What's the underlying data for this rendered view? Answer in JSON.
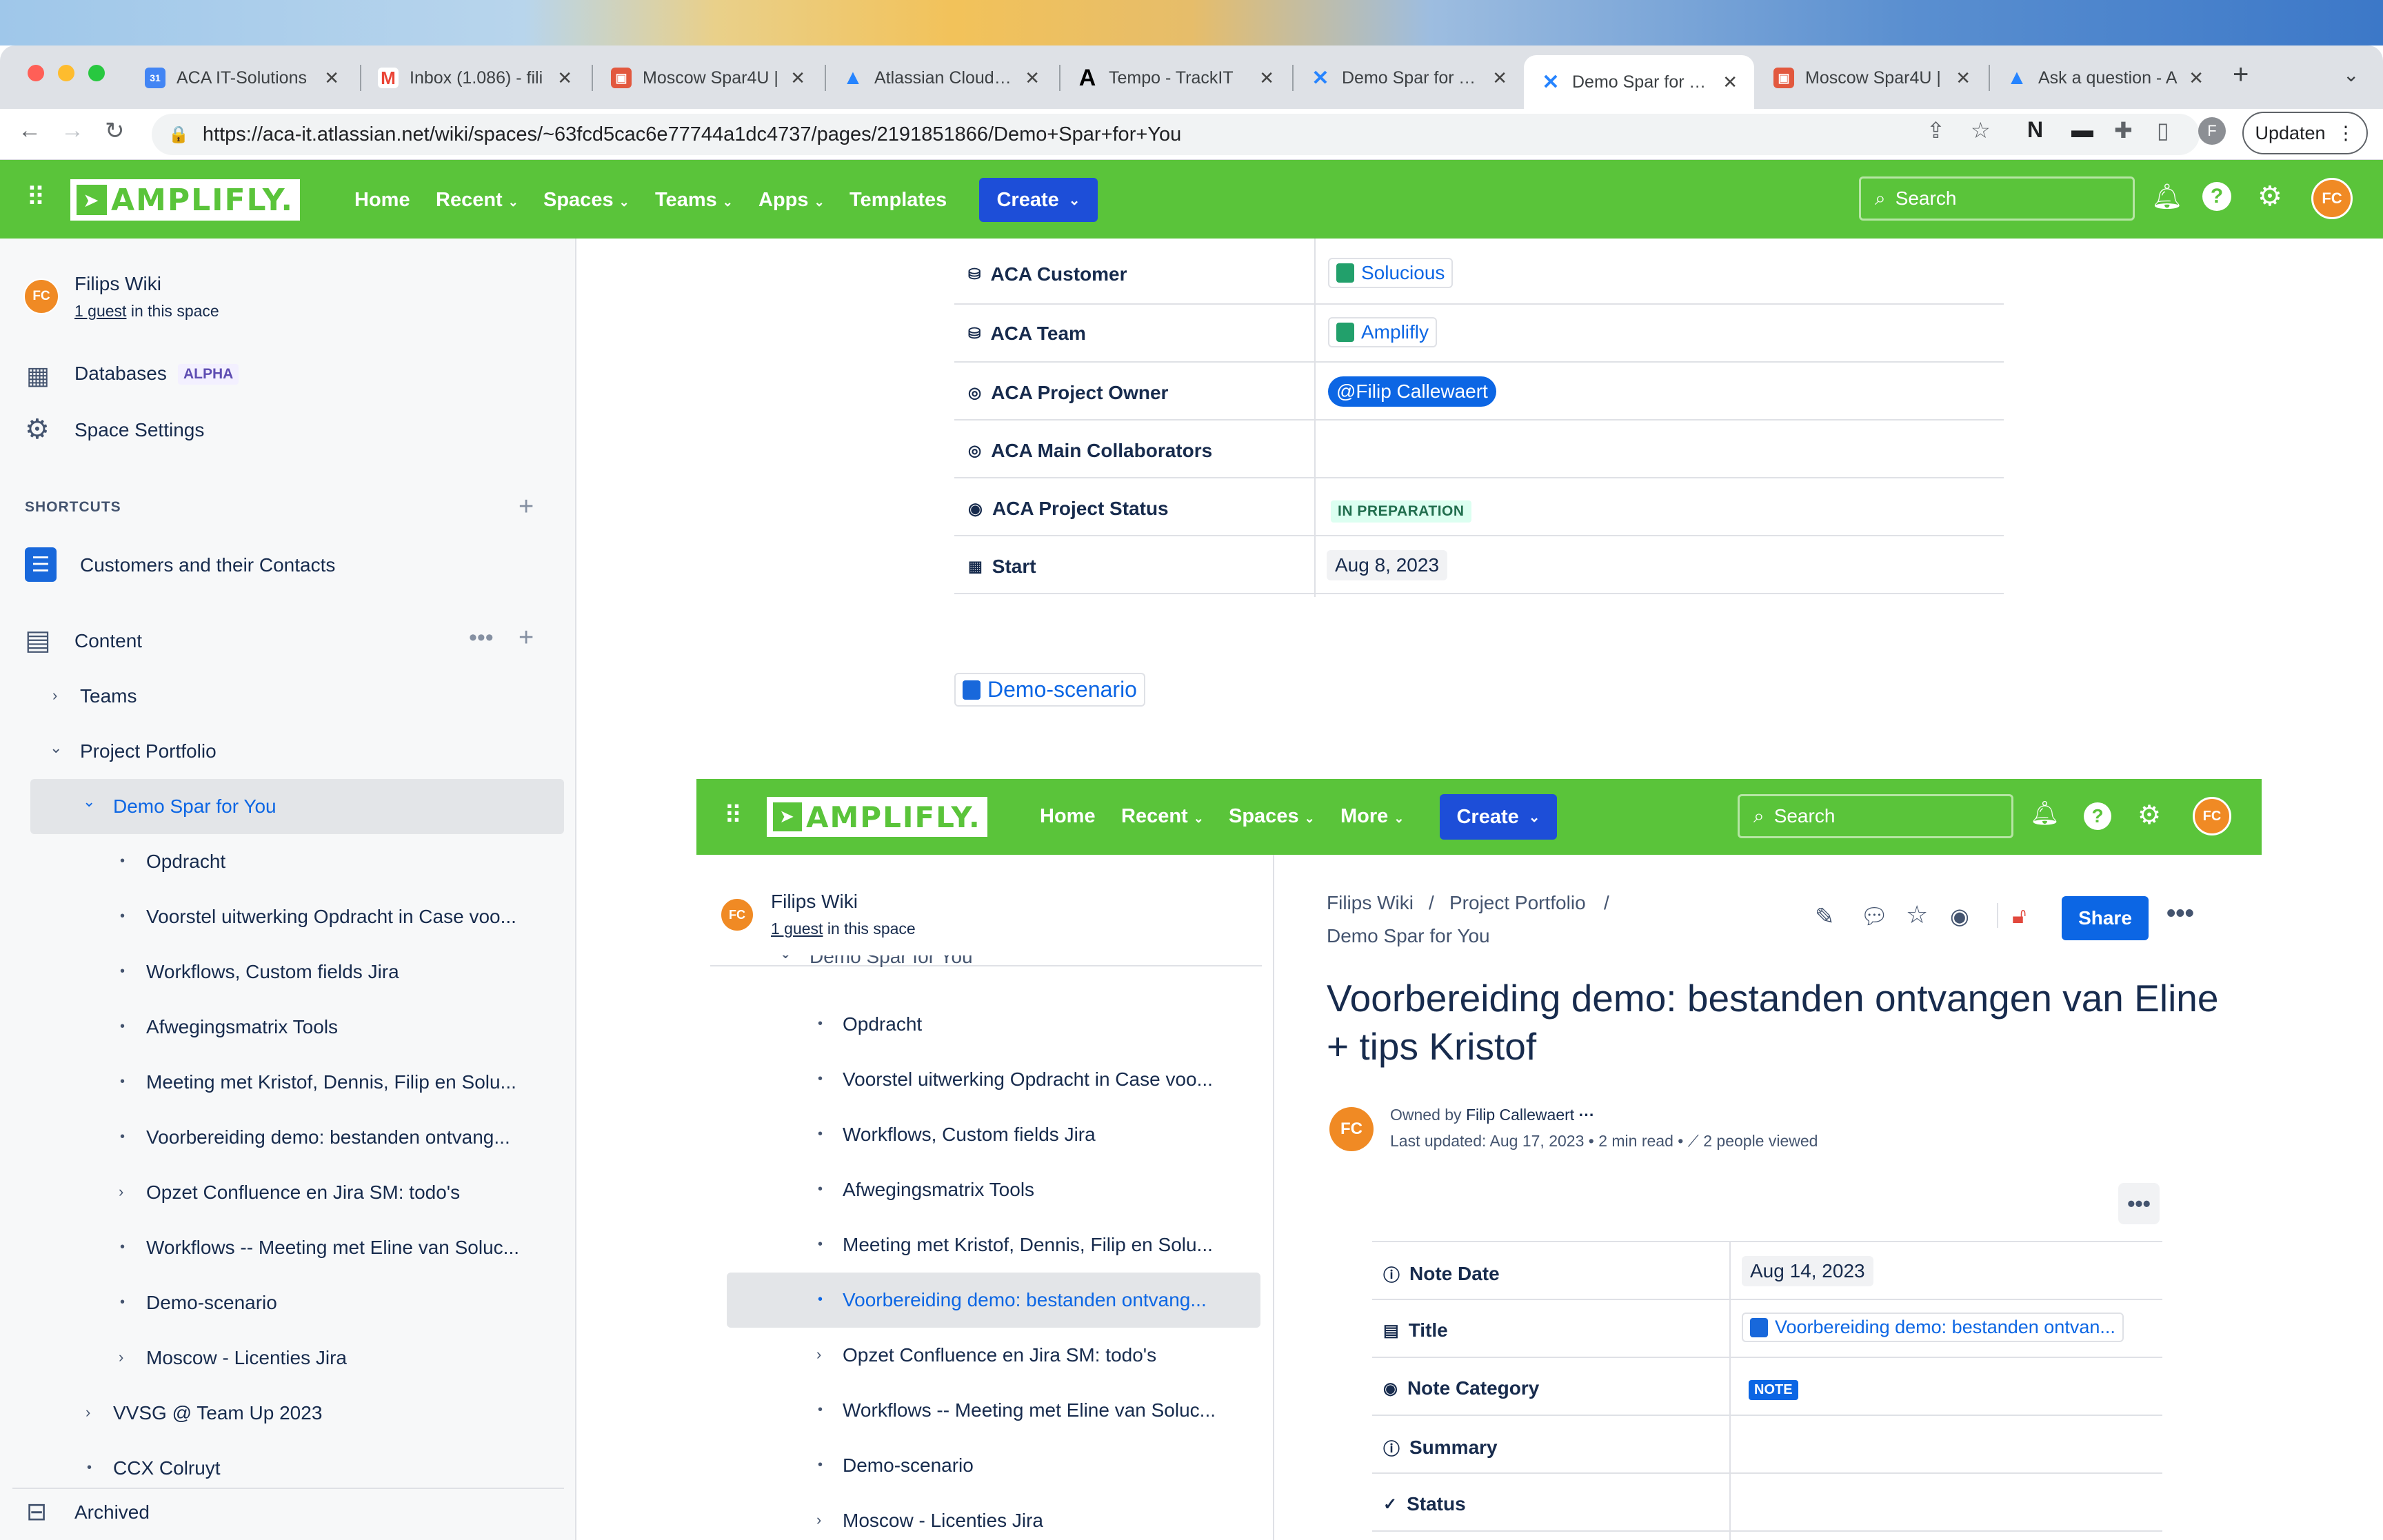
{
  "browser": {
    "tabs": [
      {
        "title": "ACA IT-Solutions",
        "favicon": "calendar-icon",
        "color": "#4285f4"
      },
      {
        "title": "Inbox (1.086) - fili",
        "favicon": "gmail-icon",
        "color": "#ea4335"
      },
      {
        "title": "Moscow Spar4U |",
        "favicon": "trello-icon",
        "color": "#e2583e"
      },
      {
        "title": "Atlassian Cloud Pr",
        "favicon": "atlassian-icon",
        "color": "#2684ff"
      },
      {
        "title": "Tempo - TrackIT",
        "favicon": "tempo-icon",
        "color": "#000000"
      },
      {
        "title": "Demo Spar for You",
        "favicon": "confluence-icon",
        "color": "#2684ff"
      },
      {
        "title": "Demo Spar for You",
        "favicon": "confluence-icon",
        "color": "#2684ff"
      },
      {
        "title": "Moscow Spar4U |",
        "favicon": "trello-icon",
        "color": "#e2583e"
      },
      {
        "title": "Ask a question - A",
        "favicon": "atlassian-icon",
        "color": "#2684ff"
      }
    ],
    "url": "https://aca-it.atlassian.net/wiki/spaces/~63fcd5cac6e77744a1dc4737/pages/2191851866/Demo+Spar+for+You",
    "profile_initial": "F",
    "update_label": "Updaten"
  },
  "topnav": {
    "logo": "AMPLIFLY.",
    "items": [
      "Home",
      "Recent",
      "Spaces",
      "Teams",
      "Apps",
      "Templates"
    ],
    "create": "Create",
    "search_placeholder": "Search",
    "avatar": "FC",
    "brand_color": "#5ac43a"
  },
  "sidebar": {
    "space_name": "Filips Wiki",
    "guest_link": "1 guest",
    "guest_suffix": " in this space",
    "avatar": "FC",
    "databases": "Databases",
    "alpha": "ALPHA",
    "space_settings": "Space Settings",
    "shortcuts_header": "SHORTCUTS",
    "shortcut_item": "Customers and their Contacts",
    "content": "Content",
    "tree": {
      "teams": "Teams",
      "project_portfolio": "Project Portfolio",
      "demo_spar": "Demo Spar for You",
      "children": [
        "Opdracht",
        "Voorstel uitwerking Opdracht in Case voo...",
        "Workflows, Custom fields Jira",
        "Afwegingsmatrix Tools",
        "Meeting met Kristof, Dennis, Filip en Solu...",
        "Voorbereiding demo: bestanden ontvang...",
        "Opzet Confluence en Jira SM: todo's",
        "Workflows -- Meeting met Eline van Soluc...",
        "Demo-scenario",
        "Moscow - Licenties Jira"
      ],
      "vvsg": "VVSG @ Team Up 2023",
      "ccx": "CCX Colruyt"
    },
    "archived": "Archived"
  },
  "main": {
    "props": [
      {
        "label": "ACA Customer",
        "icon": "database-icon",
        "value": "Solucious",
        "kind": "page"
      },
      {
        "label": "ACA Team",
        "icon": "database-icon",
        "value": "Amplifly",
        "kind": "page"
      },
      {
        "label": "ACA Project Owner",
        "icon": "mention-icon",
        "value": "@Filip Callewaert",
        "kind": "mention"
      },
      {
        "label": "ACA Main Collaborators",
        "icon": "mention-icon",
        "value": "",
        "kind": "empty"
      },
      {
        "label": "ACA Project Status",
        "icon": "status-icon",
        "value": "IN PREPARATION",
        "kind": "status"
      },
      {
        "label": "Start",
        "icon": "calendar-icon",
        "value": "Aug 8, 2023",
        "kind": "date"
      }
    ],
    "demo_link": "Demo-scenario"
  },
  "embedded": {
    "topnav": {
      "logo": "AMPLIFLY.",
      "items": [
        "Home",
        "Recent",
        "Spaces",
        "More"
      ],
      "create": "Create",
      "search_placeholder": "Search",
      "avatar": "FC"
    },
    "sidebar": {
      "space_name": "Filips Wiki",
      "guest_link": "1 guest",
      "guest_suffix": " in this space",
      "avatar": "FC",
      "demo_spar": "Demo Spar for You",
      "children": [
        "Opdracht",
        "Voorstel uitwerking Opdracht in Case voo...",
        "Workflows, Custom fields Jira",
        "Afwegingsmatrix Tools",
        "Meeting met Kristof, Dennis, Filip en Solu...",
        "Voorbereiding demo: bestanden ontvang...",
        "Opzet Confluence en Jira SM: todo's",
        "Workflows -- Meeting met Eline van Soluc...",
        "Demo-scenario",
        "Moscow - Licenties Jira"
      ]
    },
    "page": {
      "breadcrumb1": "Filips Wiki",
      "breadcrumb2": "Project Portfolio",
      "breadcrumb3": "Demo Spar for You",
      "share": "Share",
      "title_line1": "Voorbereiding demo: bestanden ontvangen van Eline",
      "title_line2": "+ tips Kristof",
      "avatar": "FC",
      "owned_by_prefix": "Owned by ",
      "owner": "Filip Callewaert",
      "last_updated": "Last updated: Aug 17, 2023",
      "read_time": "2 min read",
      "viewed": "2 people viewed",
      "props": [
        {
          "label": "Note Date",
          "icon": "info-icon",
          "value": "Aug 14, 2023"
        },
        {
          "label": "Title",
          "icon": "document-icon",
          "value": "Voorbereiding demo: bestanden ontvan..."
        },
        {
          "label": "Note Category",
          "icon": "status-icon",
          "value": "NOTE"
        },
        {
          "label": "Summary",
          "icon": "info-icon",
          "value": ""
        },
        {
          "label": "Status",
          "icon": "check-circle-icon",
          "value": ""
        }
      ]
    }
  }
}
